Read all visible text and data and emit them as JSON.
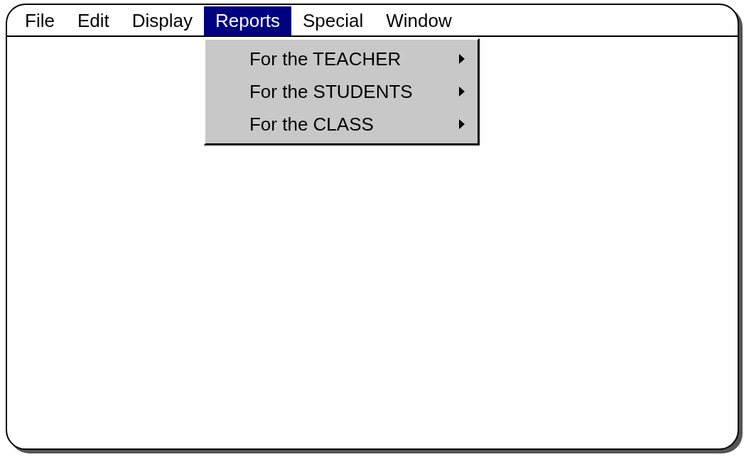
{
  "menu_bar": {
    "items": [
      {
        "label": "File",
        "selected": false
      },
      {
        "label": "Edit",
        "selected": false
      },
      {
        "label": "Display",
        "selected": false
      },
      {
        "label": "Reports",
        "selected": true,
        "dropdown": [
          {
            "label": "For the TEACHER",
            "submenu": true
          },
          {
            "label": "For the STUDENTS",
            "submenu": true
          },
          {
            "label": "For the CLASS",
            "submenu": true
          }
        ]
      },
      {
        "label": "Special",
        "selected": false
      },
      {
        "label": "Window",
        "selected": false
      }
    ]
  }
}
